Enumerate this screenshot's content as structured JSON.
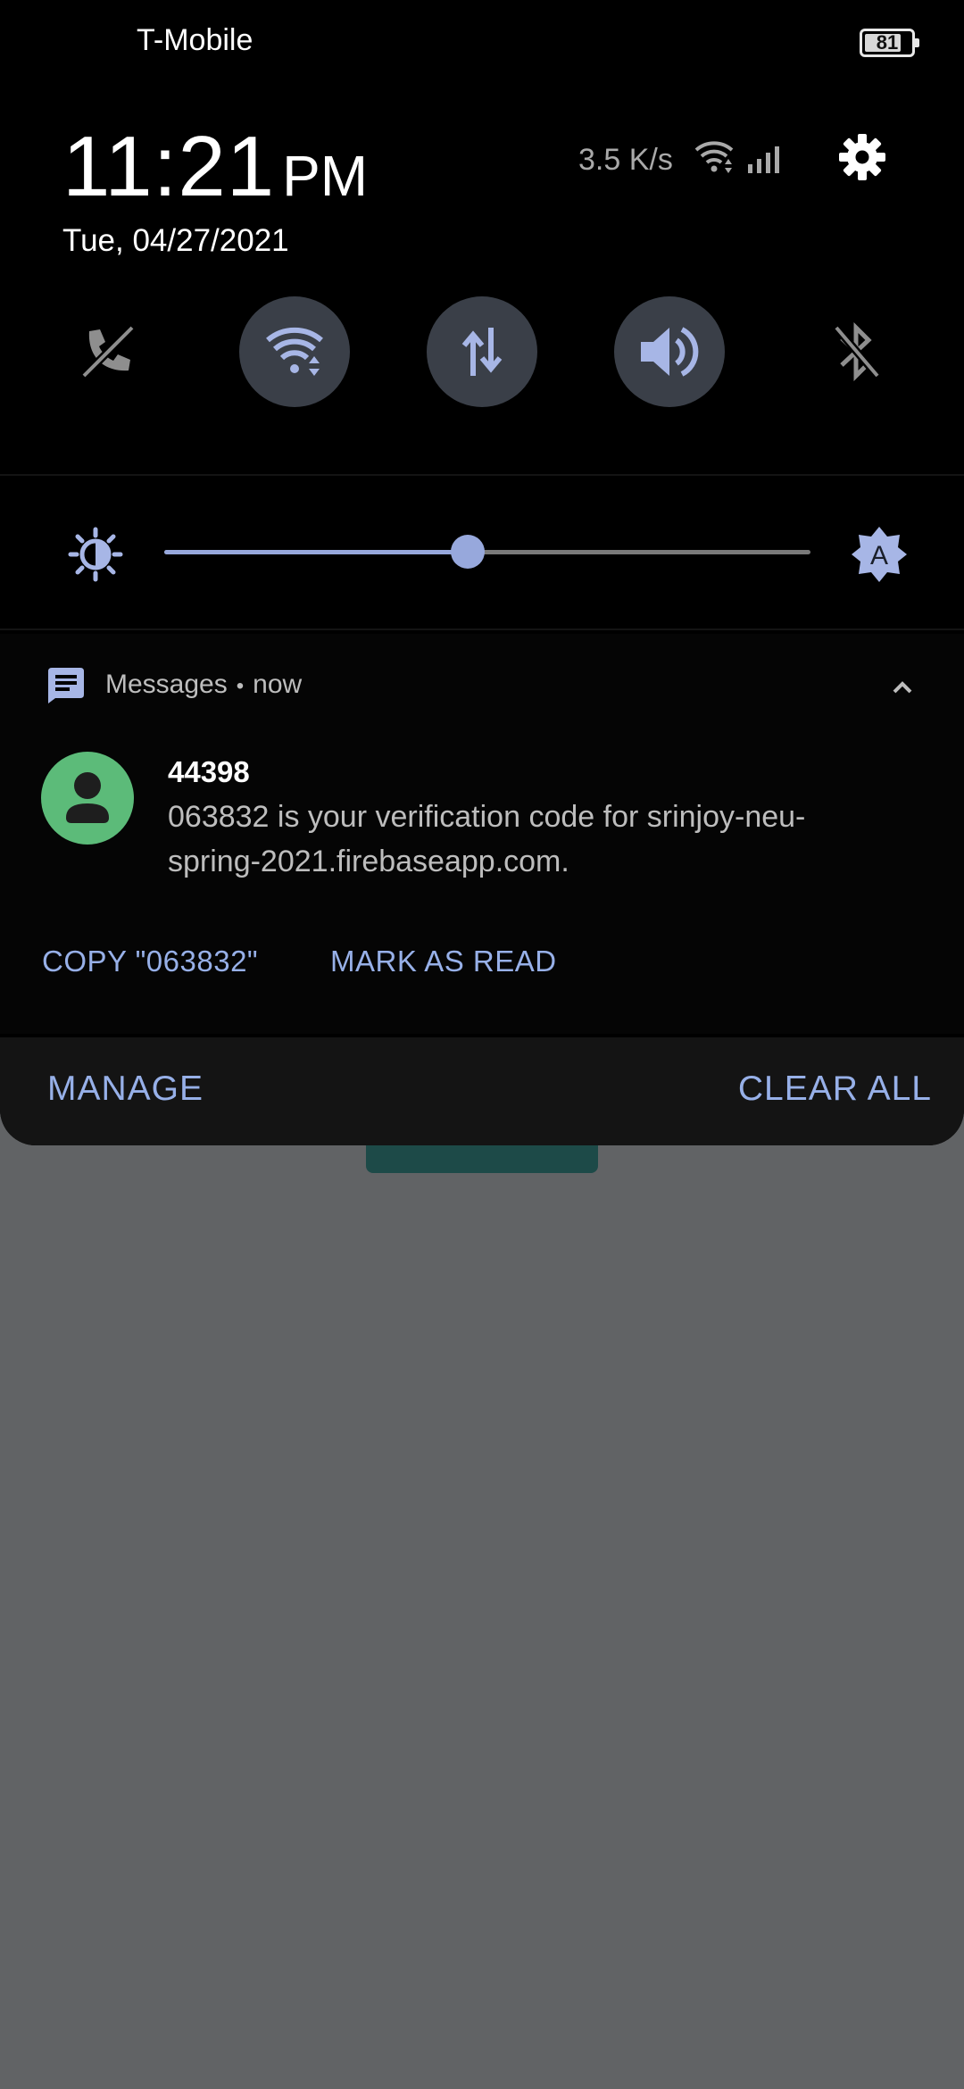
{
  "status_bar": {
    "carrier": "T-Mobile",
    "battery_level": "81"
  },
  "header": {
    "time": "11:21",
    "ampm": "PM",
    "date": "Tue, 04/27/2021",
    "net_speed": "3.5 K/s"
  },
  "quick_tiles": [
    {
      "name": "calls-off",
      "icon": "phone-off-icon",
      "active": false
    },
    {
      "name": "wifi",
      "icon": "wifi-icon",
      "active": true
    },
    {
      "name": "mobile-data",
      "icon": "data-arrows-icon",
      "active": true
    },
    {
      "name": "sound",
      "icon": "volume-icon",
      "active": true
    },
    {
      "name": "bluetooth",
      "icon": "bluetooth-off-icon",
      "active": false
    }
  ],
  "brightness": {
    "level": 0.47,
    "auto_label": "A"
  },
  "notification": {
    "app": "Messages",
    "time": "now",
    "sender": "44398",
    "body": "063832 is your verification code for srinjoy-neu-spring-2021.firebaseapp.com.",
    "actions": {
      "copy": "COPY \"063832\"",
      "mark_read": "MARK AS READ"
    }
  },
  "footer": {
    "manage": "MANAGE",
    "clear_all": "CLEAR ALL"
  },
  "colors": {
    "accent": "#97b0e8",
    "tile_active_bg": "#3a3f48",
    "avatar_bg": "#5cbb79",
    "shade_bg": "#000000",
    "scrim": "#616365"
  }
}
